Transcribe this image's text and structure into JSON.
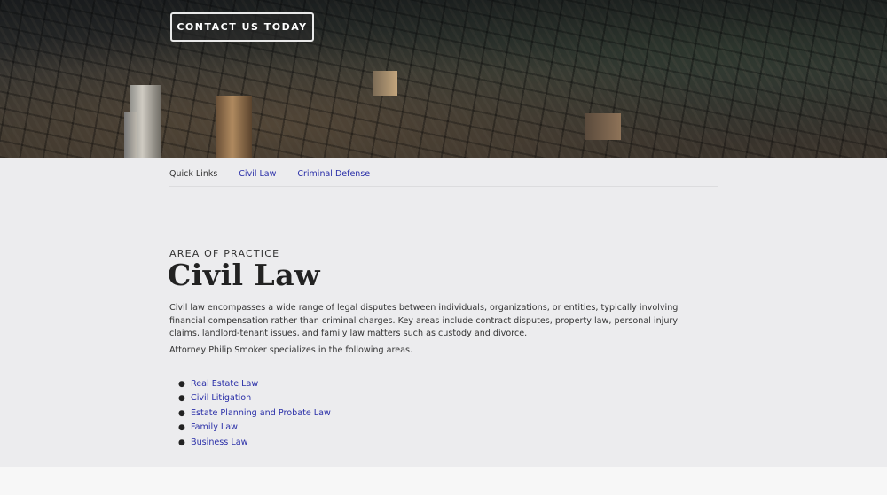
{
  "hero": {
    "cta_label": "CONTACT US TODAY"
  },
  "quick_links": {
    "label": "Quick Links",
    "links": [
      "Civil Law",
      "Criminal Defense"
    ]
  },
  "practice": {
    "eyebrow": "AREA OF PRACTICE",
    "title": "Civil Law",
    "description": "Civil law encompasses a wide range of legal disputes between individuals, organizations, or entities, typically involving financial compensation rather than criminal charges. Key areas include contract disputes, property law, personal injury claims, landlord-tenant issues, and family law matters such as custody and divorce.",
    "intro": "Attorney Philip Smoker specializes in the following areas.",
    "areas": [
      "Real Estate Law",
      "Civil Litigation",
      "Estate Planning and Probate Law",
      "Family Law",
      "Business Law"
    ]
  },
  "colors": {
    "link": "#2a2fa8",
    "panel_bg": "#ececee",
    "text": "#333333"
  }
}
